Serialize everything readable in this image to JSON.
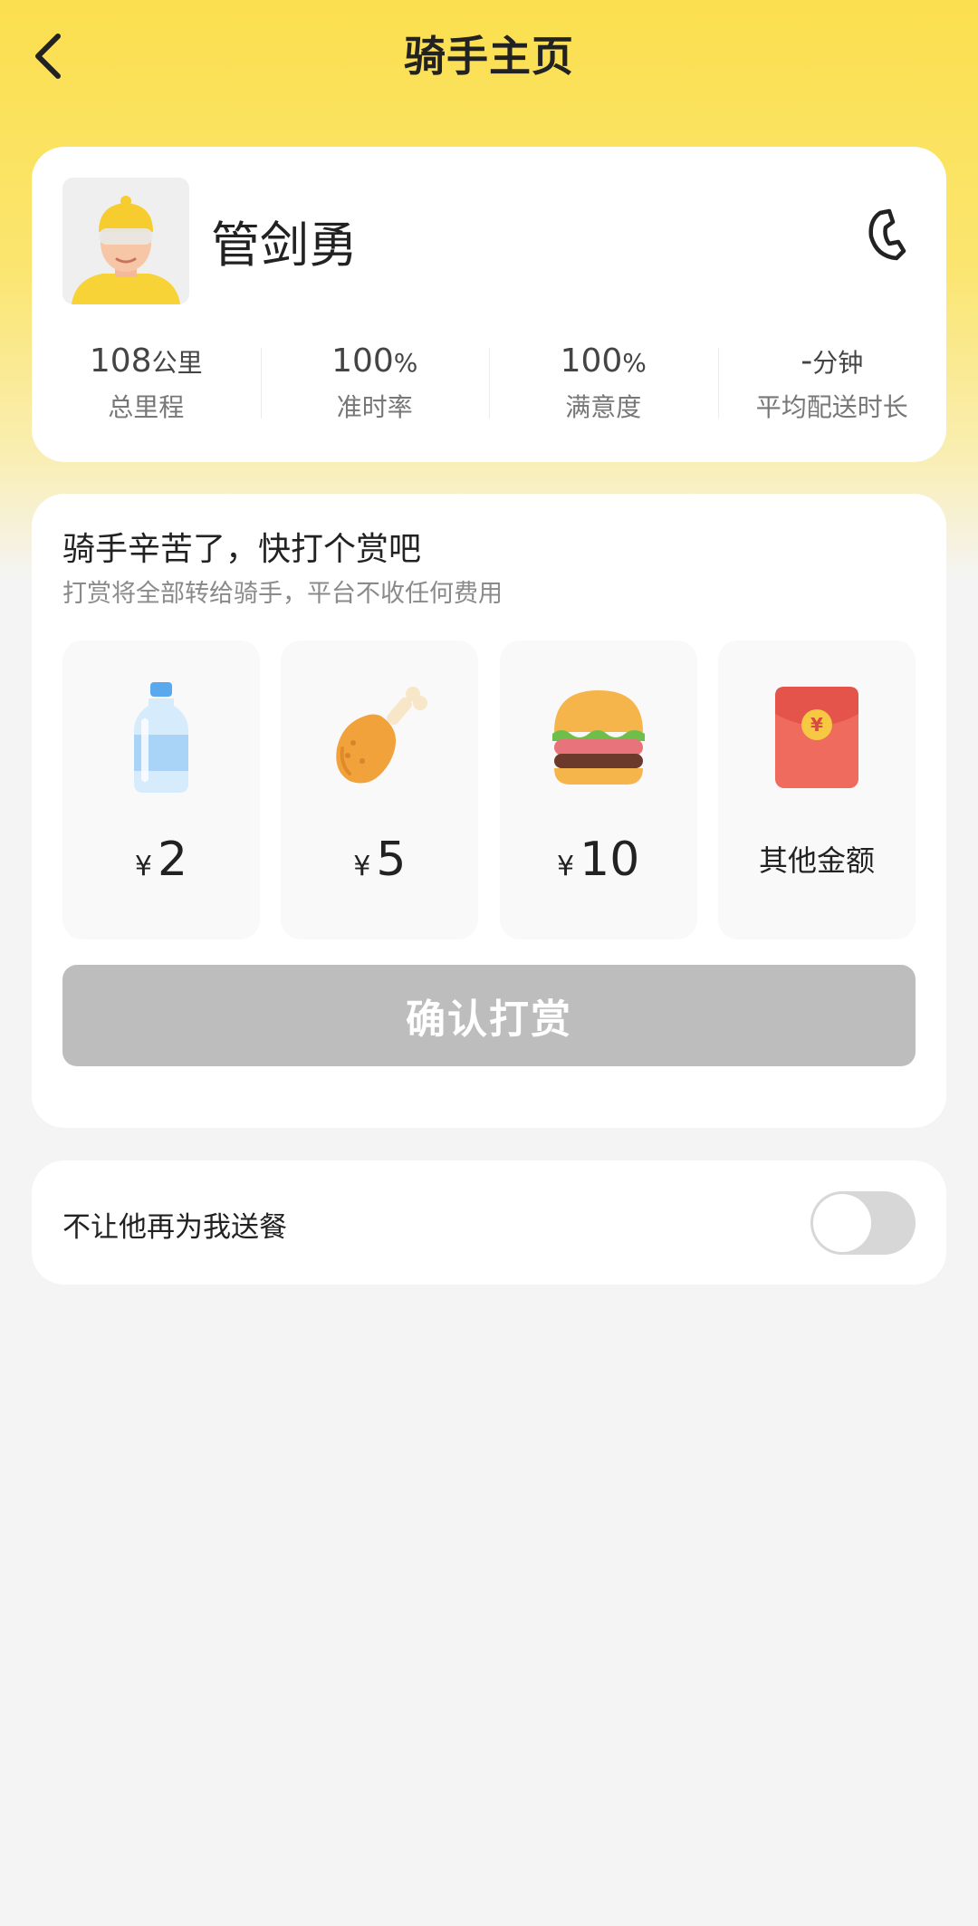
{
  "header": {
    "title": "骑手主页",
    "back_icon": "chevron-left-icon"
  },
  "rider": {
    "name": "管剑勇",
    "phone_icon": "phone-icon",
    "stats": [
      {
        "value": "108",
        "unit": "公里",
        "label": "总里程"
      },
      {
        "value": "100",
        "unit": "%",
        "label": "准时率"
      },
      {
        "value": "100",
        "unit": "%",
        "label": "满意度"
      },
      {
        "value": "-",
        "unit": "分钟",
        "label": "平均配送时长"
      }
    ]
  },
  "reward": {
    "title": "骑手辛苦了，快打个赏吧",
    "subtitle": "打赏将全部转给骑手，平台不收任何费用",
    "currency": "¥",
    "options": [
      {
        "icon": "water-bottle-icon",
        "amount": "2"
      },
      {
        "icon": "chicken-leg-icon",
        "amount": "5"
      },
      {
        "icon": "burger-icon",
        "amount": "10"
      },
      {
        "icon": "red-envelope-icon",
        "label": "其他金额"
      }
    ],
    "confirm_label": "确认打赏",
    "confirm_color": "#bdbdbd"
  },
  "block": {
    "label": "不让他再为我送餐",
    "toggle_on": false
  },
  "colors": {
    "accent": "#fbdf4f",
    "background": "#f4f4f4"
  }
}
